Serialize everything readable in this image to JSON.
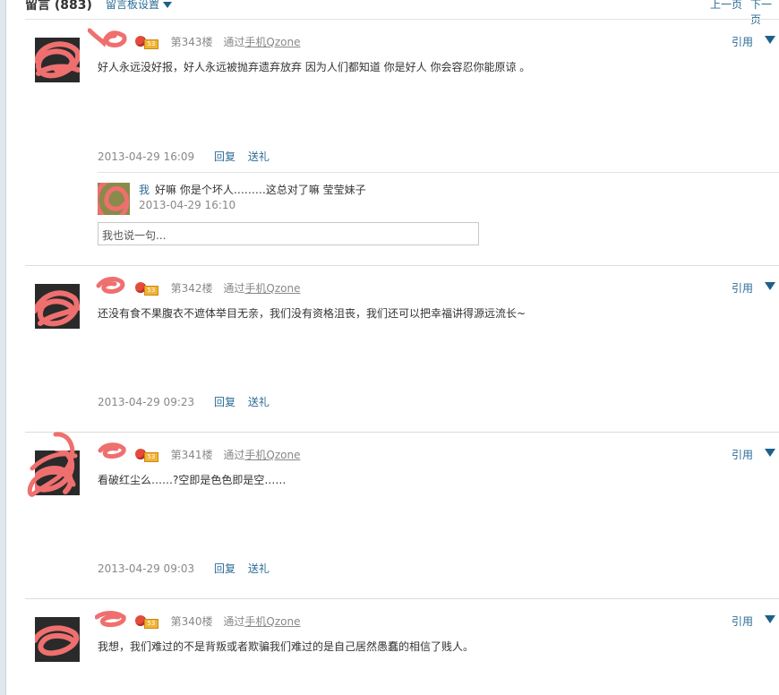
{
  "header": {
    "title": "留言 (883)",
    "settings_label": "留言板设置",
    "prev_label": "上一页",
    "next_label": "下一页"
  },
  "posts": [
    {
      "floor": "第343楼",
      "via_prefix": "通过",
      "via_link": "手机Qzone",
      "quote_label": "引用",
      "content": "好人永远没好报，好人永远被抛弃遗弃放弃  因为人们都知道  你是好人  你会容忍你能原谅 。",
      "time": "2013-04-29 16:09",
      "reply_label": "回复",
      "gift_label": "送礼",
      "level_badge": "53",
      "reply": {
        "author": "我",
        "text": "好嘛 你是个坏人………这总对了嘛 莹莹妹子",
        "time": "2013-04-29 16:10",
        "input_placeholder": "我也说一句..."
      }
    },
    {
      "floor": "第342楼",
      "via_prefix": "通过",
      "via_link": "手机Qzone",
      "quote_label": "引用",
      "content": "还没有食不果腹衣不遮体举目无亲，我们没有资格沮丧，我们还可以把幸福讲得源远流长~",
      "time": "2013-04-29 09:23",
      "reply_label": "回复",
      "gift_label": "送礼",
      "level_badge": "53"
    },
    {
      "floor": "第341楼",
      "via_prefix": "通过",
      "via_link": "手机Qzone",
      "quote_label": "引用",
      "content": "看破红尘么……?空即是色色即是空……",
      "time": "2013-04-29 09:03",
      "reply_label": "回复",
      "gift_label": "送礼",
      "level_badge": "53"
    },
    {
      "floor": "第340楼",
      "via_prefix": "通过",
      "via_link": "手机Qzone",
      "quote_label": "引用",
      "content": "我想，我们难过的不是背叛或者欺骗我们难过的是自己居然愚蠢的相信了贱人。",
      "level_badge": "53"
    }
  ],
  "colors": {
    "link_blue": "#2b6c96",
    "meta_gray": "#888888",
    "redaction_pink": "#ef6f6f"
  },
  "icons": {
    "settings_dropdown": "triangle-down",
    "more_menu": "triangle-down",
    "level_badge": "apple-level"
  }
}
